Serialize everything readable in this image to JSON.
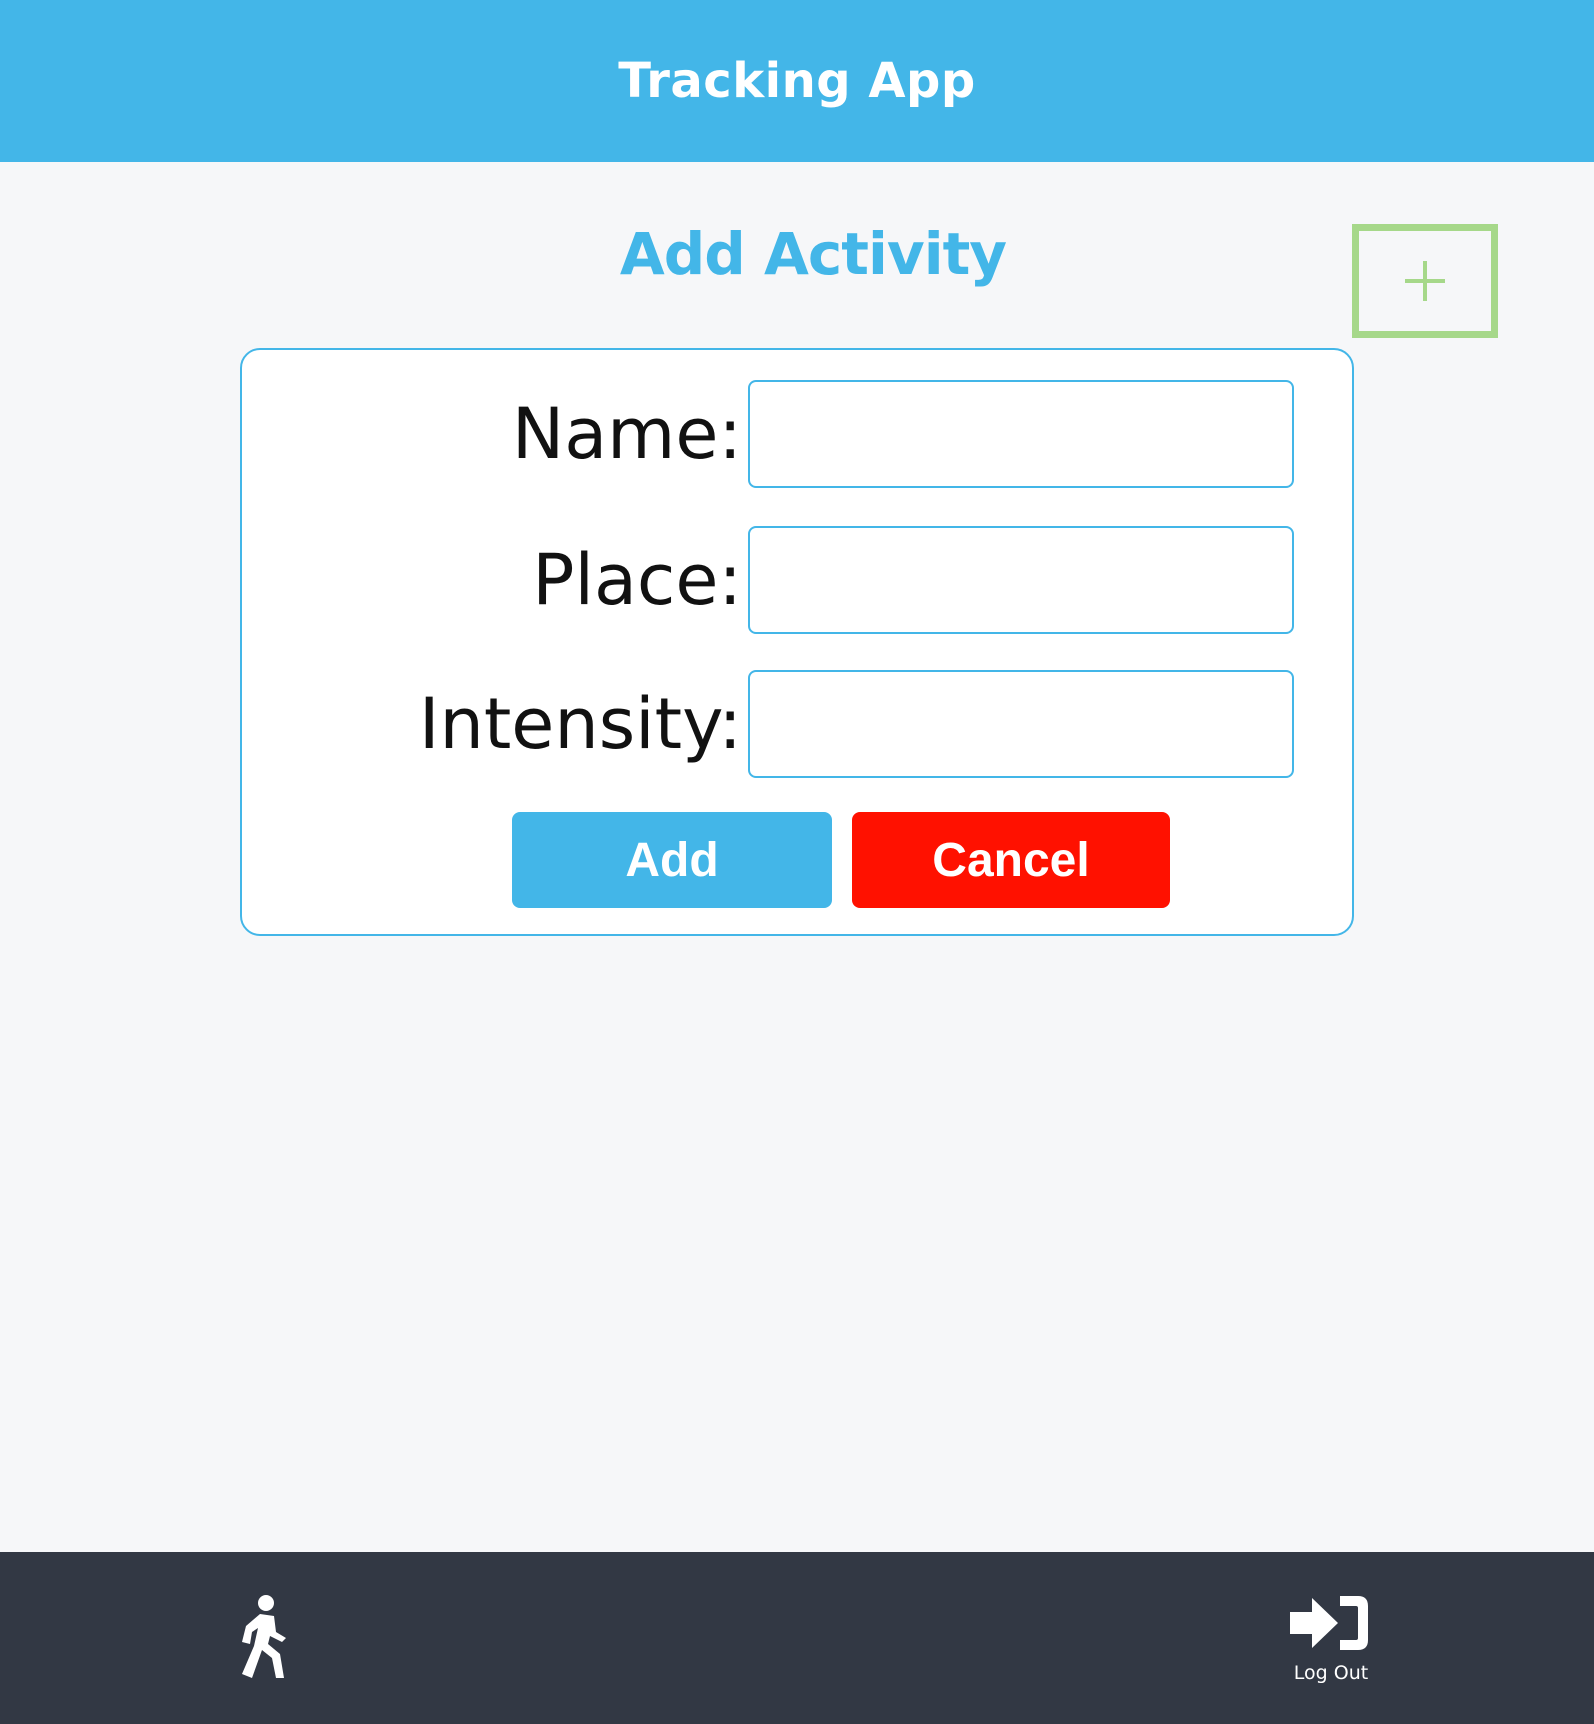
{
  "header": {
    "title": "Tracking App",
    "background_color": "#43b6e8"
  },
  "page": {
    "title": "Add Activity",
    "add_toggle_icon": "plus-icon",
    "add_toggle_color": "#a6d88a"
  },
  "form": {
    "fields": [
      {
        "label": "Name:",
        "value": "",
        "placeholder": ""
      },
      {
        "label": "Place:",
        "value": "",
        "placeholder": ""
      },
      {
        "label": "Intensity:",
        "value": "",
        "placeholder": ""
      }
    ],
    "add_label": "Add",
    "add_color": "#43b6e8",
    "cancel_label": "Cancel",
    "cancel_color": "#ff1100"
  },
  "bottom_nav": {
    "background_color": "#323844",
    "items": [
      {
        "icon": "walking-person-icon",
        "label": ""
      },
      {
        "icon": "sign-in-arrow-icon",
        "label": "Log Out"
      }
    ]
  }
}
